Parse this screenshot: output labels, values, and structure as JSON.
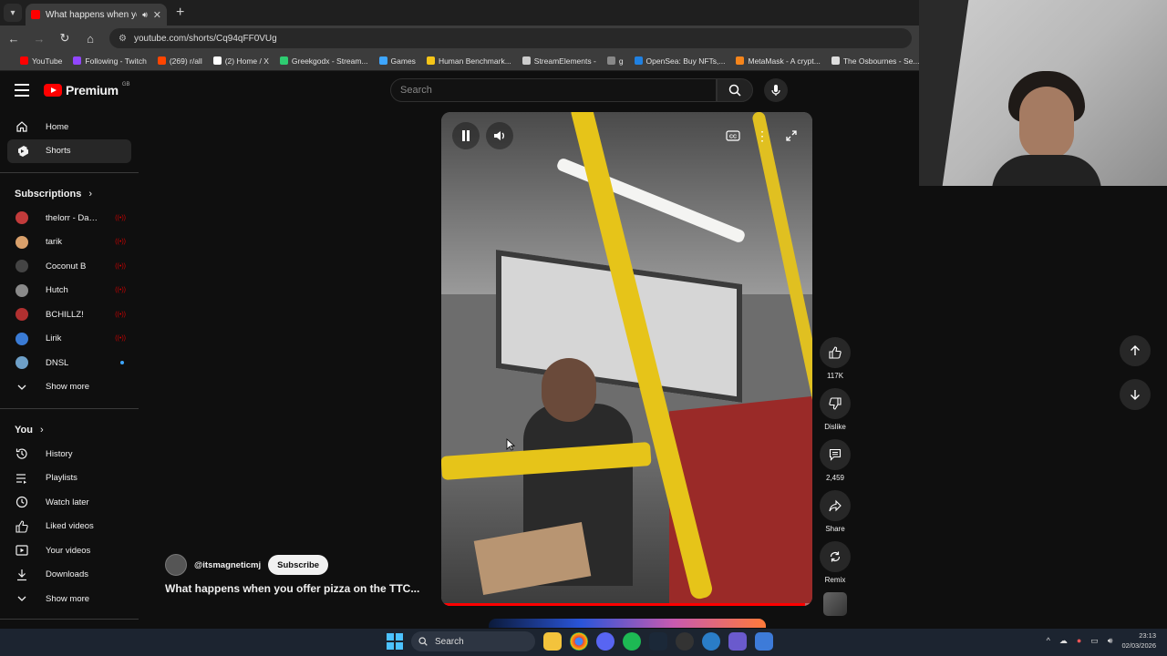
{
  "browser": {
    "tab_title": "What happens when you offer pizza",
    "url": "youtube.com/shorts/Cq94qFF0VUg",
    "bookmarks": [
      {
        "label": "YouTube",
        "color": "#ff0000"
      },
      {
        "label": "Following - Twitch",
        "color": "#9146ff"
      },
      {
        "label": "(269) r/all",
        "color": "#ff4500"
      },
      {
        "label": "(2) Home / X",
        "color": "#ffffff"
      },
      {
        "label": "Greekgodx - Stream...",
        "color": "#2ecc71"
      },
      {
        "label": "Games",
        "color": "#3ea6ff"
      },
      {
        "label": "Human Benchmark...",
        "color": "#f5c518"
      },
      {
        "label": "StreamElements -",
        "color": "#cccccc"
      },
      {
        "label": "g",
        "color": "#888888"
      },
      {
        "label": "OpenSea: Buy NFTs,...",
        "color": "#2081e2"
      },
      {
        "label": "MetaMask - A crypt...",
        "color": "#f6851b"
      },
      {
        "label": "The Osbournes - Se...",
        "color": "#dddddd"
      }
    ]
  },
  "youtube": {
    "logo_text": "Premium",
    "logo_region": "GB",
    "search_placeholder": "Search",
    "sidebar": {
      "main": [
        {
          "label": "Home",
          "icon": "home-icon",
          "active": false
        },
        {
          "label": "Shorts",
          "icon": "shorts-icon",
          "active": true
        }
      ],
      "subscriptions_heading": "Subscriptions",
      "subscriptions": [
        {
          "label": "thelorr - Dark an...",
          "color": "#c23b3b",
          "live": true
        },
        {
          "label": "tarik",
          "color": "#d9a06b",
          "live": true
        },
        {
          "label": "Coconut B",
          "color": "#444444",
          "live": true
        },
        {
          "label": "Hutch",
          "color": "#8a8a8a",
          "live": true
        },
        {
          "label": "BCHILLZ!",
          "color": "#b03030",
          "live": true
        },
        {
          "label": "Lirik",
          "color": "#3a7bd5",
          "live": true
        },
        {
          "label": "DNSL",
          "color": "#6ea0c8",
          "live": false,
          "new": true
        }
      ],
      "subs_show_more": "Show more",
      "you_heading": "You",
      "you_items": [
        {
          "label": "History",
          "icon": "history-icon"
        },
        {
          "label": "Playlists",
          "icon": "playlists-icon"
        },
        {
          "label": "Watch later",
          "icon": "watch-later-icon"
        },
        {
          "label": "Liked videos",
          "icon": "liked-icon"
        },
        {
          "label": "Your videos",
          "icon": "your-videos-icon"
        },
        {
          "label": "Downloads",
          "icon": "downloads-icon"
        }
      ],
      "you_show_more": "Show more"
    },
    "short": {
      "channel": "@itsmagneticmj",
      "subscribe_label": "Subscribe",
      "title": "What happens when you offer pizza on the TTC...",
      "progress": 0.98,
      "likes": "117K",
      "dislike_label": "Dislike",
      "comments": "2,459",
      "share_label": "Share",
      "remix_label": "Remix"
    }
  },
  "taskbar": {
    "search_label": "Search",
    "time": "23:13",
    "date": "02/03/2026"
  }
}
